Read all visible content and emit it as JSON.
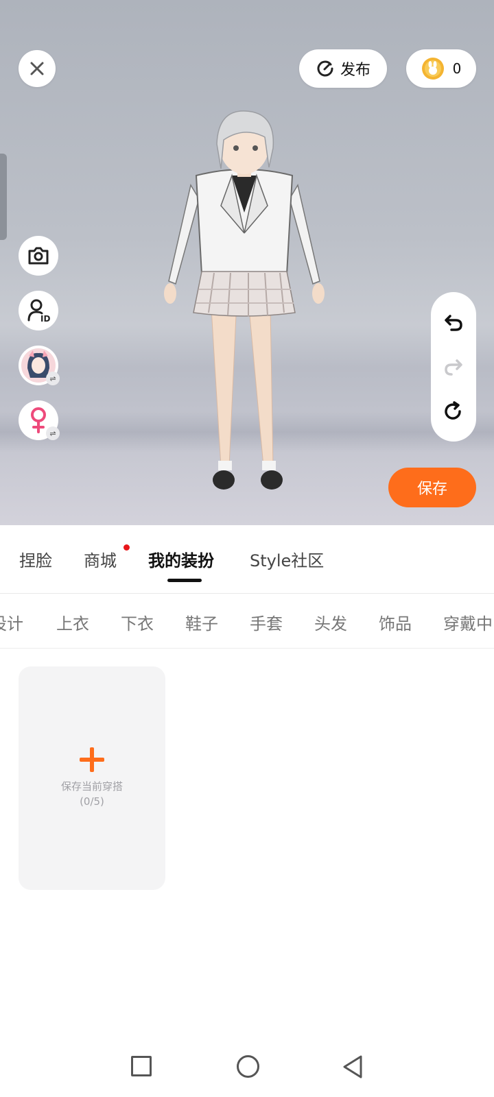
{
  "toolbar": {
    "publish_label": "发布",
    "coin_count": "0"
  },
  "actions": {
    "save_label": "保存"
  },
  "main_tabs": [
    {
      "label": "捏脸"
    },
    {
      "label": "商城"
    },
    {
      "label": "我的装扮"
    },
    {
      "label": "Style社区"
    }
  ],
  "active_main_tab": "我的装扮",
  "sub_tabs": [
    {
      "label": "设计"
    },
    {
      "label": "上衣"
    },
    {
      "label": "下衣"
    },
    {
      "label": "鞋子"
    },
    {
      "label": "手套"
    },
    {
      "label": "头发"
    },
    {
      "label": "饰品"
    },
    {
      "label": "穿戴中"
    }
  ],
  "outfit_card": {
    "label": "保存当前穿搭",
    "count": "(0/5)"
  },
  "colors": {
    "accent": "#fe6d1b",
    "notification_dot": "#e8161b"
  },
  "icons": {
    "close": "close-icon",
    "publish": "publish-icon",
    "coin": "coin-icon",
    "camera": "camera-icon",
    "profile_id": "profile-id-icon",
    "avatar_switch": "avatar-switch",
    "gender_female": "female-gender-icon",
    "undo": "undo-icon",
    "redo": "redo-icon",
    "reset": "reset-icon"
  }
}
